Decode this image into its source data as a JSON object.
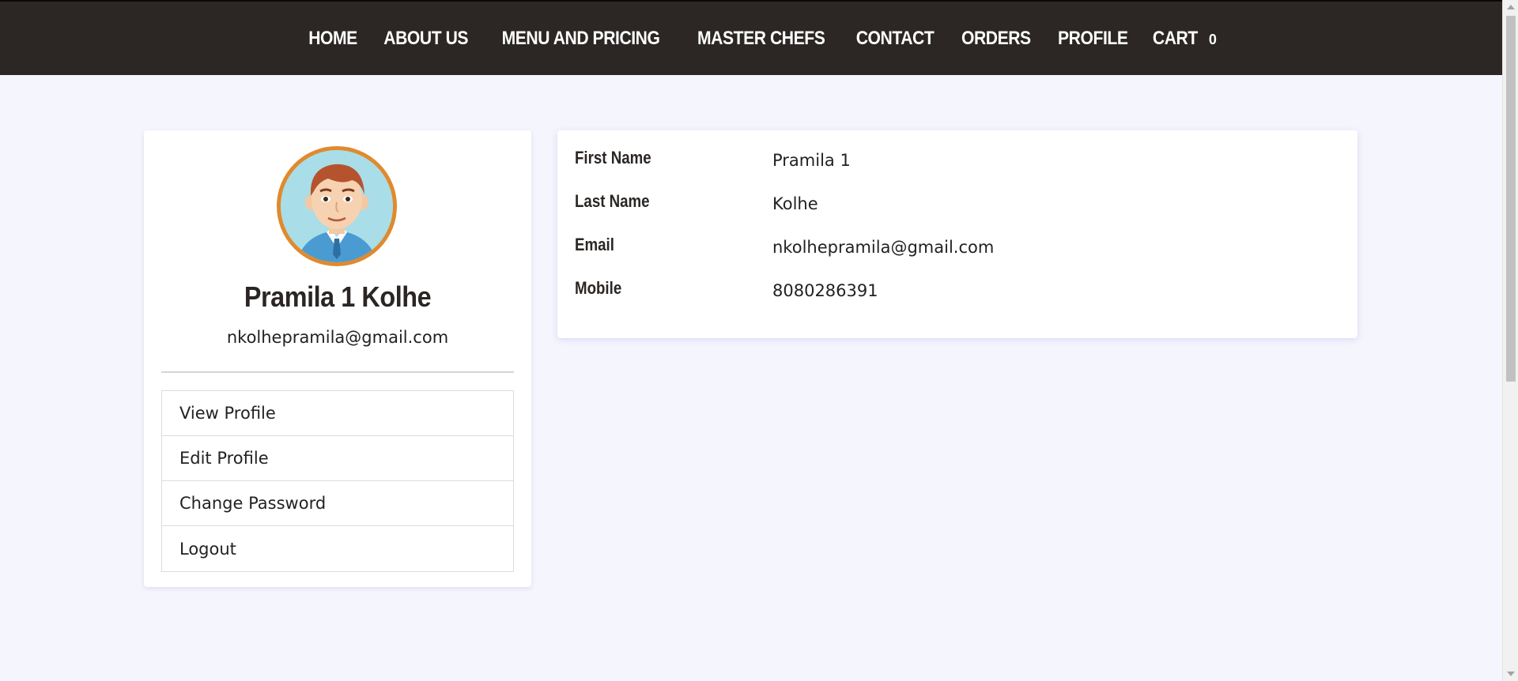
{
  "nav": {
    "items": [
      {
        "label": "HOME"
      },
      {
        "label": "ABOUT US"
      },
      {
        "label": "MENU AND PRICING"
      },
      {
        "label": "MASTER CHEFS"
      },
      {
        "label": "CONTACT"
      },
      {
        "label": "ORDERS"
      },
      {
        "label": "PROFILE"
      },
      {
        "label": "CART"
      }
    ],
    "cart_count": "0"
  },
  "profile_card": {
    "name": "Pramila 1 Kolhe",
    "email": "nkolhepramila@gmail.com",
    "avatar_icon": "user-avatar-icon",
    "menu": [
      {
        "label": "View Profile"
      },
      {
        "label": "Edit Profile"
      },
      {
        "label": "Change Password"
      },
      {
        "label": "Logout"
      }
    ]
  },
  "details": {
    "rows": [
      {
        "label": "First Name",
        "value": "Pramila 1"
      },
      {
        "label": "Last Name",
        "value": "Kolhe"
      },
      {
        "label": "Email",
        "value": "nkolhepramila@gmail.com"
      },
      {
        "label": "Mobile",
        "value": "8080286391"
      }
    ]
  },
  "colors": {
    "navbar_bg": "#2c2724",
    "page_bg": "#f5f5fd",
    "avatar_border": "#e08a2d"
  }
}
